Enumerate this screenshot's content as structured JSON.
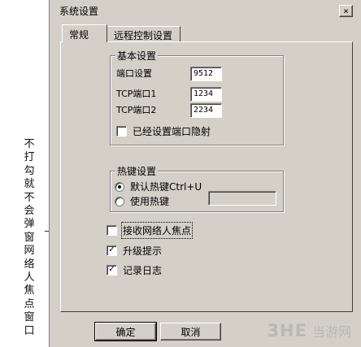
{
  "annotation": {
    "text": "不打勾就不会弹窗网络人焦点窗口"
  },
  "window": {
    "title": "系统设置",
    "close_glyph": "×"
  },
  "tabs": [
    {
      "label": "常规"
    },
    {
      "label": "远程控制设置"
    }
  ],
  "basic_group": {
    "legend": "基本设置",
    "fields": [
      {
        "label": "端口设置",
        "value": "9512"
      },
      {
        "label": "TCP端口1",
        "value": "1234"
      },
      {
        "label": "TCP端口2",
        "value": "2234"
      }
    ],
    "port_mapping": {
      "label": "已经设置端口隐射",
      "checked": false
    }
  },
  "hotkey_group": {
    "legend": "热键设置",
    "default_option": {
      "label": "默认热键Ctrl+U",
      "selected": true
    },
    "custom_option": {
      "label": "使用热键",
      "selected": false
    },
    "custom_value": ""
  },
  "options": [
    {
      "label": "接收网络人焦点",
      "checked": false
    },
    {
      "label": "升级提示",
      "checked": true
    },
    {
      "label": "记录日志",
      "checked": true
    }
  ],
  "buttons": {
    "ok": "确定",
    "cancel": "取消"
  },
  "watermark": {
    "logo": "3HE",
    "text": "当游网"
  },
  "icons": {
    "check": "✓"
  }
}
